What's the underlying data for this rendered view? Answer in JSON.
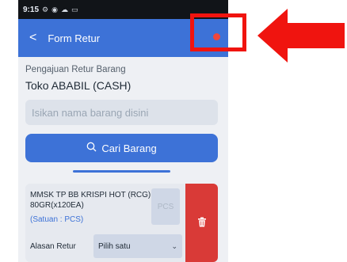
{
  "statusbar": {
    "time": "9:15",
    "icons": [
      "settings-icon",
      "signal-icon",
      "cloud-icon",
      "message-icon"
    ]
  },
  "appbar": {
    "back_glyph": "<",
    "title": "Form Retur"
  },
  "form": {
    "subtitle": "Pengajuan Retur Barang",
    "shop": "Toko ABABIL (CASH)",
    "search_placeholder": "Isikan nama barang disini",
    "search_button": "Cari Barang"
  },
  "item": {
    "name": "MMSK TP BB KRISPI HOT (RCG) 80GR(x120EA)",
    "satuan": "(Satuan : PCS)",
    "qty_placeholder": "PCS",
    "reason_label": "Alasan Retur",
    "reason_value": "Pilih satu"
  },
  "annotation": {
    "highlight_color": "#f0140f",
    "arrow_color": "#f0140f"
  }
}
